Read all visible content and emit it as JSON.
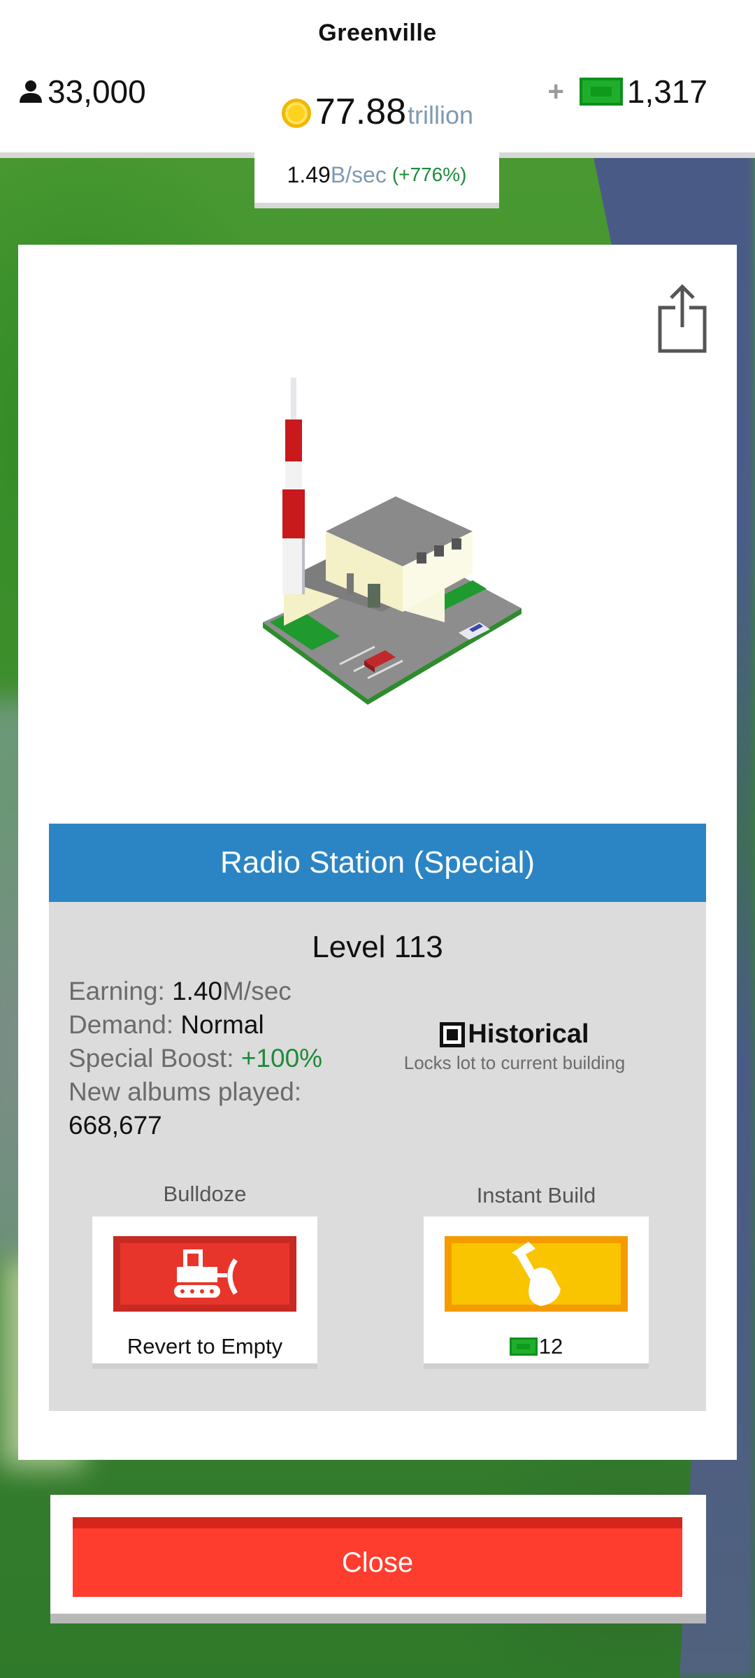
{
  "header": {
    "city_name": "Greenville",
    "population": "33,000",
    "money_amount": "77.88",
    "money_unit": "trillion",
    "plus_symbol": "+",
    "gems": "1,317",
    "income_rate": "1.49",
    "income_unit": "B/sec",
    "income_change": "(+776%)"
  },
  "building": {
    "name": "Radio Station (Special)",
    "level": "Level 113",
    "earning_label": "Earning: ",
    "earning_value": "1.40",
    "earning_unit": "M/sec",
    "demand_label": "Demand: ",
    "demand_value": "Normal",
    "boost_label": "Special Boost: ",
    "boost_value": "+100%",
    "albums_label": "New albums played:",
    "albums_value": "668,677"
  },
  "historical": {
    "label": "Historical",
    "description": "Locks lot to current building",
    "checked": true
  },
  "actions": {
    "bulldoze_label": "Bulldoze",
    "bulldoze_caption": "Revert to Empty",
    "instant_label": "Instant Build",
    "instant_cost": "12"
  },
  "close_label": "Close",
  "colors": {
    "title_bar": "#2b85c4",
    "bulldoze": "#e8352b",
    "instant": "#f9c400",
    "close": "#ff3d2e",
    "positive": "#1e8a3a"
  },
  "icons": [
    "person-icon",
    "coin-icon",
    "cash-icon",
    "share-icon",
    "bulldozer-icon",
    "hammer-hand-icon"
  ]
}
